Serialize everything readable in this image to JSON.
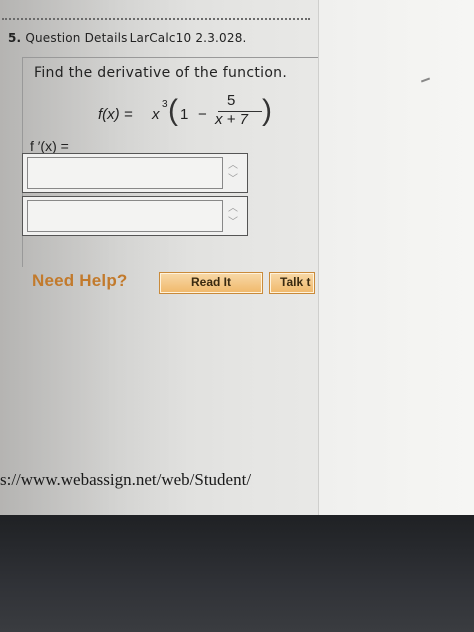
{
  "question": {
    "number": "5.",
    "source_label": "Question Details",
    "question_id": "LarCalc10 2.3.028.",
    "prompt": "Find the derivative of the function."
  },
  "formula": {
    "lhs": "f(x) = ",
    "base": "x",
    "exponent": "3",
    "one": "1",
    "minus": "−",
    "numerator": "5",
    "denominator": "x + 7"
  },
  "answer": {
    "label": "f ′(x) =",
    "input1_value": "",
    "input2_value": "",
    "spinner_up": "︿",
    "spinner_down": "﹀"
  },
  "help": {
    "need_help_label": "Need Help?",
    "read_it_label": "Read It",
    "talk_label": "Talk t"
  },
  "browser": {
    "url_text": "s://www.webassign.net/web/Student/"
  }
}
